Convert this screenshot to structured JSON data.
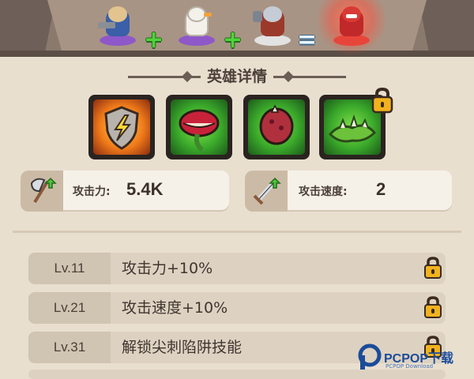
{
  "recipe": {
    "units": [
      {
        "icon": "knight-unit-icon",
        "pad_color": "#8f58c8",
        "body_color": "#3b5fa8"
      },
      {
        "icon": "goose-unit-icon",
        "pad_color": "#8f58c8",
        "body_color": "#f3f1ea"
      },
      {
        "icon": "viking-unit-icon",
        "pad_color": "#e2e2e2",
        "body_color": "#9b3a2a"
      },
      {
        "icon": "plant-monster-unit-icon",
        "pad_color": "#e8453a",
        "body_color": "#c0282a"
      }
    ],
    "plus": "+",
    "equals": "="
  },
  "section": {
    "title": "英雄详情"
  },
  "skills": [
    {
      "icon": "lightning-shield-icon",
      "locked": false
    },
    {
      "icon": "venus-flytrap-icon",
      "locked": false
    },
    {
      "icon": "spiky-plant-icon",
      "locked": false
    },
    {
      "icon": "spike-trap-icon",
      "locked": true
    }
  ],
  "stats": {
    "attack": {
      "label": "攻击力:",
      "value": "5.4K",
      "icon": "axe-upgrade-icon"
    },
    "speed": {
      "label": "攻击速度:",
      "value": "2",
      "icon": "sword-speed-icon"
    }
  },
  "levels": [
    {
      "level": "Lv.11",
      "desc": "攻击力+10%",
      "locked": true
    },
    {
      "level": "Lv.21",
      "desc": "攻击速度+10%",
      "locked": true
    },
    {
      "level": "Lv.31",
      "desc": "解锁尖刺陷阱技能",
      "locked": true
    }
  ],
  "watermark": {
    "name": "PCPOP下载",
    "sub": "PCPOP Download"
  },
  "colors": {
    "background": "#e9dfcf",
    "plus_green": "#52d23a",
    "lock_gold": "#f2b21e"
  }
}
